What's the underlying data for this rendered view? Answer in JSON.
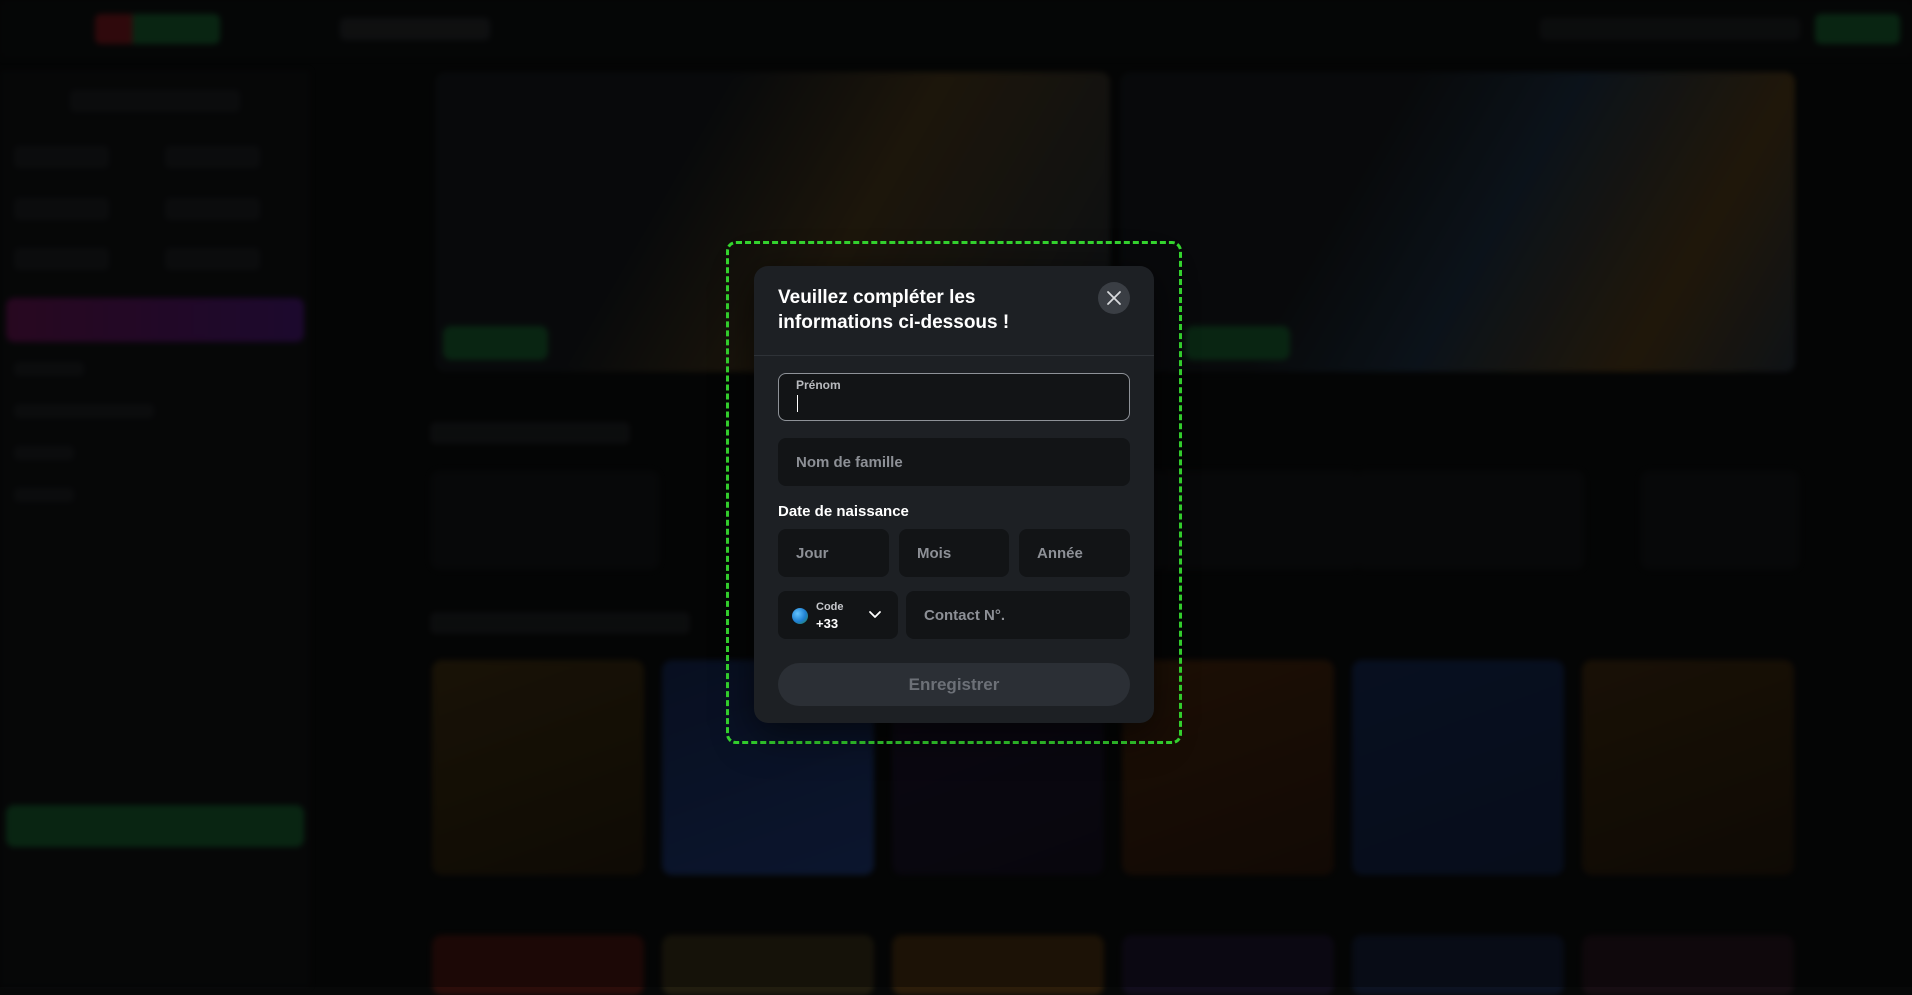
{
  "modal": {
    "title": "Veuillez compléter les informations ci-dessous !",
    "first_name": {
      "label": "Prénom",
      "value": ""
    },
    "last_name": {
      "placeholder": "Nom de famille"
    },
    "dob": {
      "label": "Date de naissance",
      "day_placeholder": "Jour",
      "month_placeholder": "Mois",
      "year_placeholder": "Année"
    },
    "phone": {
      "code_label": "Code",
      "code_value": "+33",
      "number_placeholder": "Contact N°."
    },
    "save_label": "Enregistrer"
  },
  "colors": {
    "modal_bg": "#1d2024",
    "highlight": "#35d62f",
    "brand_green": "#1fa34a"
  }
}
